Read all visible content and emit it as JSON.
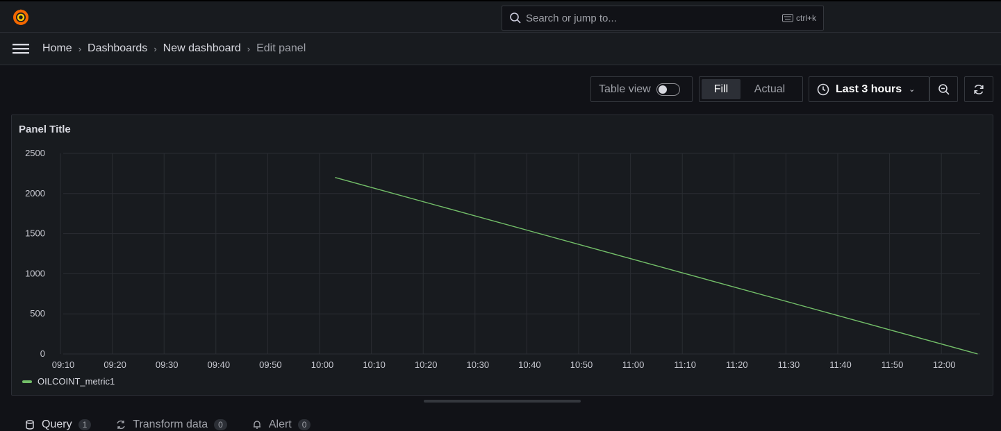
{
  "search": {
    "placeholder": "Search or jump to...",
    "shortcut": "ctrl+k"
  },
  "breadcrumb": [
    "Home",
    "Dashboards",
    "New dashboard",
    "Edit panel"
  ],
  "toolbar": {
    "table_view_label": "Table view",
    "table_view_enabled": false,
    "fill_label": "Fill",
    "actual_label": "Actual",
    "time_range_label": "Last 3 hours"
  },
  "panel": {
    "title": "Panel Title"
  },
  "chart_data": {
    "type": "line",
    "title": "Panel Title",
    "x_ticks": [
      "09:10",
      "09:20",
      "09:30",
      "09:40",
      "09:50",
      "10:00",
      "10:10",
      "10:20",
      "10:30",
      "10:40",
      "10:50",
      "11:00",
      "11:10",
      "11:20",
      "11:30",
      "11:40",
      "11:50",
      "12:00"
    ],
    "y_ticks": [
      0,
      500,
      1000,
      1500,
      2000,
      2500
    ],
    "ylim": [
      0,
      2500
    ],
    "grid": true,
    "legend_position": "bottom-left",
    "series": [
      {
        "name": "OILCOINT_metric1",
        "color": "#73bf69",
        "points": [
          {
            "x": "10:03",
            "y": 2200
          },
          {
            "x": "12:07",
            "y": 0
          }
        ]
      }
    ]
  },
  "tabs": [
    {
      "label": "Query",
      "count": "1"
    },
    {
      "label": "Transform data",
      "count": "0"
    },
    {
      "label": "Alert",
      "count": "0"
    }
  ]
}
